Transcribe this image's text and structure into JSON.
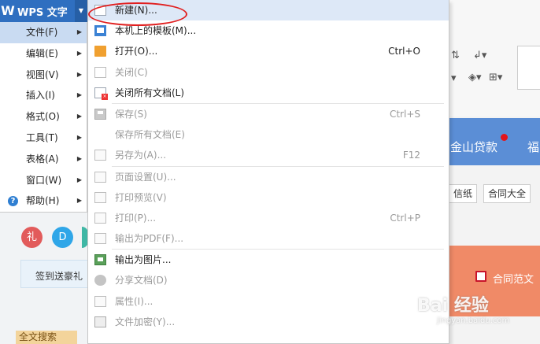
{
  "app": {
    "logo": "W",
    "title": "WPS 文字"
  },
  "main_menu": [
    {
      "label": "文件(F)",
      "active": true
    },
    {
      "label": "编辑(E)"
    },
    {
      "label": "视图(V)"
    },
    {
      "label": "插入(I)"
    },
    {
      "label": "格式(O)"
    },
    {
      "label": "工具(T)"
    },
    {
      "label": "表格(A)"
    },
    {
      "label": "窗口(W)"
    },
    {
      "label": "帮助(H)"
    }
  ],
  "file_menu": [
    {
      "label": "新建(N)...",
      "shortcut": "",
      "icon": "new-doc-icon",
      "enabled": true
    },
    {
      "label": "本机上的模板(M)...",
      "shortcut": "",
      "icon": "template-icon",
      "enabled": true
    },
    {
      "label": "打开(O)...",
      "shortcut": "Ctrl+O",
      "icon": "folder-icon",
      "enabled": true
    },
    {
      "label": "关闭(C)",
      "shortcut": "",
      "icon": "close-doc-icon",
      "enabled": false
    },
    {
      "label": "关闭所有文档(L)",
      "shortcut": "",
      "icon": "close-all-icon",
      "enabled": true
    },
    {
      "label": "保存(S)",
      "shortcut": "Ctrl+S",
      "icon": "save-icon",
      "enabled": false
    },
    {
      "label": "保存所有文档(E)",
      "shortcut": "",
      "icon": "",
      "enabled": false
    },
    {
      "label": "另存为(A)...",
      "shortcut": "F12",
      "icon": "save-as-icon",
      "enabled": false
    },
    {
      "label": "页面设置(U)...",
      "shortcut": "",
      "icon": "page-setup-icon",
      "enabled": false
    },
    {
      "label": "打印预览(V)",
      "shortcut": "",
      "icon": "print-preview-icon",
      "enabled": false
    },
    {
      "label": "打印(P)...",
      "shortcut": "Ctrl+P",
      "icon": "print-icon",
      "enabled": false
    },
    {
      "label": "输出为PDF(F)...",
      "shortcut": "",
      "icon": "pdf-icon",
      "enabled": false
    },
    {
      "label": "输出为图片...",
      "shortcut": "",
      "icon": "image-export-icon",
      "enabled": true
    },
    {
      "label": "分享文档(D)",
      "shortcut": "",
      "icon": "share-icon",
      "enabled": false
    },
    {
      "label": "属性(I)...",
      "shortcut": "",
      "icon": "properties-icon",
      "enabled": false
    },
    {
      "label": "文件加密(Y)...",
      "shortcut": "",
      "icon": "encrypt-icon",
      "enabled": false
    }
  ],
  "background": {
    "banner_text_1": "金山贷款",
    "banner_text_2": "福",
    "tag_1": "信纸",
    "tag_2": "合同大全",
    "contract_link": "合同范文",
    "circle_1": "礼",
    "circle_2": "D",
    "signin": "签到送豪礼",
    "search_tag": "全文搜索",
    "watermark": "Bai 经验",
    "watermark_sub": "jingyan.baidu.com"
  },
  "colors": {
    "wps_blue": "#2f6fc0",
    "highlight": "#dde8f7",
    "annotation": "#e11f1f",
    "banner": "#5b8ed6",
    "orange": "#f08a67"
  }
}
